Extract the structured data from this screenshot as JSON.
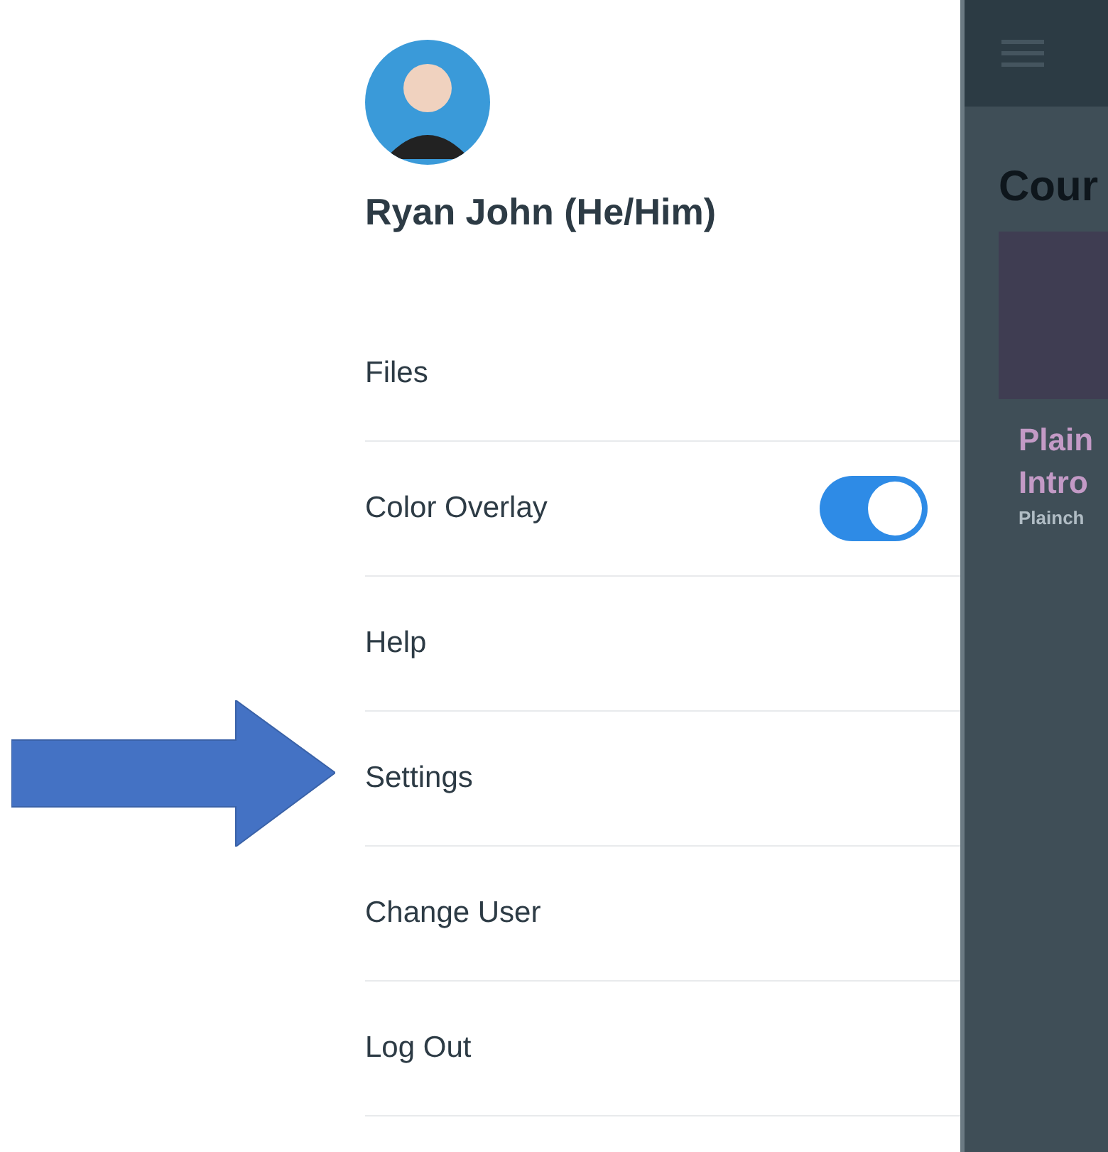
{
  "drawer": {
    "user_name": "Ryan John (He/Him)",
    "items": [
      {
        "kind": "link",
        "label": "Files"
      },
      {
        "kind": "toggle",
        "label": "Color Overlay",
        "on": true
      },
      {
        "kind": "link",
        "label": "Help"
      },
      {
        "kind": "link",
        "label": "Settings"
      },
      {
        "kind": "link",
        "label": "Change User"
      },
      {
        "kind": "link",
        "label": "Log Out"
      }
    ]
  },
  "background_page": {
    "heading": "Cour",
    "card": {
      "title_lines": [
        "Plain",
        "Intro"
      ],
      "subtitle": "Plainch"
    }
  }
}
